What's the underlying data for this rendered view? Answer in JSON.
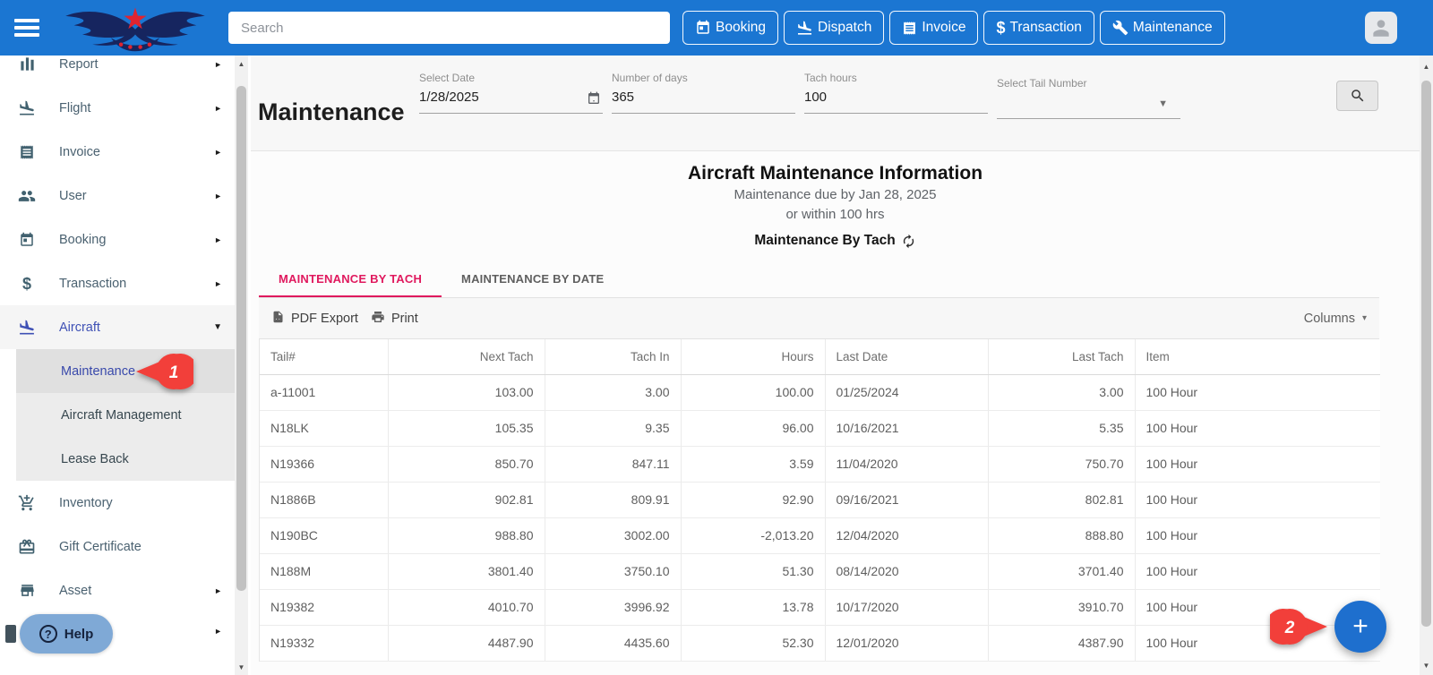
{
  "colors": {
    "topbar_blue": "#1b76d2",
    "active_tab_pink": "#e0195e",
    "selected_nav_indigo": "#3f51b5",
    "fab_blue": "#1e6fce",
    "marker_red": "#f23f3a",
    "help_pill_blue": "#7fa9d6"
  },
  "icons": {
    "chevron_right": "►",
    "chevron_down": "▼",
    "dropdown_arrow": "▼",
    "columns_arrow": "▾",
    "scroll_up": "▲",
    "scroll_down": "▼",
    "dollar": "$",
    "plus": "+",
    "help_q": "?"
  },
  "topbar": {
    "search_placeholder": "Search",
    "nav_buttons": [
      {
        "label": "Booking",
        "icon": "calendar-icon"
      },
      {
        "label": "Dispatch",
        "icon": "plane-landing-icon"
      },
      {
        "label": "Invoice",
        "icon": "receipt-icon"
      },
      {
        "label": "Transaction",
        "icon": "dollar-icon"
      },
      {
        "label": "Maintenance",
        "icon": "wrench-icon"
      }
    ]
  },
  "sidebar": {
    "items": [
      {
        "label": "Report"
      },
      {
        "label": "Flight"
      },
      {
        "label": "Invoice"
      },
      {
        "label": "User"
      },
      {
        "label": "Booking"
      },
      {
        "label": "Transaction"
      },
      {
        "label": "Aircraft",
        "expanded": true
      }
    ],
    "submenu": [
      {
        "label": "Maintenance",
        "selected": true
      },
      {
        "label": "Aircraft Management"
      },
      {
        "label": "Lease Back"
      }
    ],
    "items_lower": [
      {
        "label": "Inventory"
      },
      {
        "label": "Gift Certificate"
      },
      {
        "label": "Asset"
      }
    ],
    "help_label": "Help"
  },
  "filters": {
    "page_title": "Maintenance",
    "select_date": {
      "label": "Select Date",
      "value": "1/28/2025"
    },
    "number_of_days": {
      "label": "Number of days",
      "value": "365"
    },
    "tach_hours": {
      "label": "Tach hours",
      "value": "100"
    },
    "select_tail_number": {
      "label": "Select Tail Number",
      "value": ""
    }
  },
  "info": {
    "title": "Aircraft Maintenance Information",
    "subtitle_line1": "Maintenance due by Jan 28, 2025",
    "subtitle_line2": "or within 100 hrs",
    "section_title": "Maintenance By Tach"
  },
  "tabs": [
    {
      "label": "MAINTENANCE BY TACH",
      "active": true
    },
    {
      "label": "MAINTENANCE BY DATE",
      "active": false
    }
  ],
  "toolbar": {
    "pdf_export_label": "PDF Export",
    "print_label": "Print",
    "columns_label": "Columns"
  },
  "table": {
    "headers": [
      "Tail#",
      "Next Tach",
      "Tach In",
      "Hours",
      "Last Date",
      "Last Tach",
      "Item"
    ],
    "rows": [
      [
        "a-11001",
        "103.00",
        "3.00",
        "100.00",
        "01/25/2024",
        "3.00",
        "100 Hour"
      ],
      [
        "N18LK",
        "105.35",
        "9.35",
        "96.00",
        "10/16/2021",
        "5.35",
        "100 Hour"
      ],
      [
        "N19366",
        "850.70",
        "847.11",
        "3.59",
        "11/04/2020",
        "750.70",
        "100 Hour"
      ],
      [
        "N1886B",
        "902.81",
        "809.91",
        "92.90",
        "09/16/2021",
        "802.81",
        "100 Hour"
      ],
      [
        "N190BC",
        "988.80",
        "3002.00",
        "-2,013.20",
        "12/04/2020",
        "888.80",
        "100 Hour"
      ],
      [
        "N188M",
        "3801.40",
        "3750.10",
        "51.30",
        "08/14/2020",
        "3701.40",
        "100 Hour"
      ],
      [
        "N19382",
        "4010.70",
        "3996.92",
        "13.78",
        "10/17/2020",
        "3910.70",
        "100 Hour"
      ],
      [
        "N19332",
        "4487.90",
        "4435.60",
        "52.30",
        "12/01/2020",
        "4387.90",
        "100 Hour"
      ]
    ]
  },
  "annotations": {
    "marker1": "1",
    "marker2": "2"
  }
}
